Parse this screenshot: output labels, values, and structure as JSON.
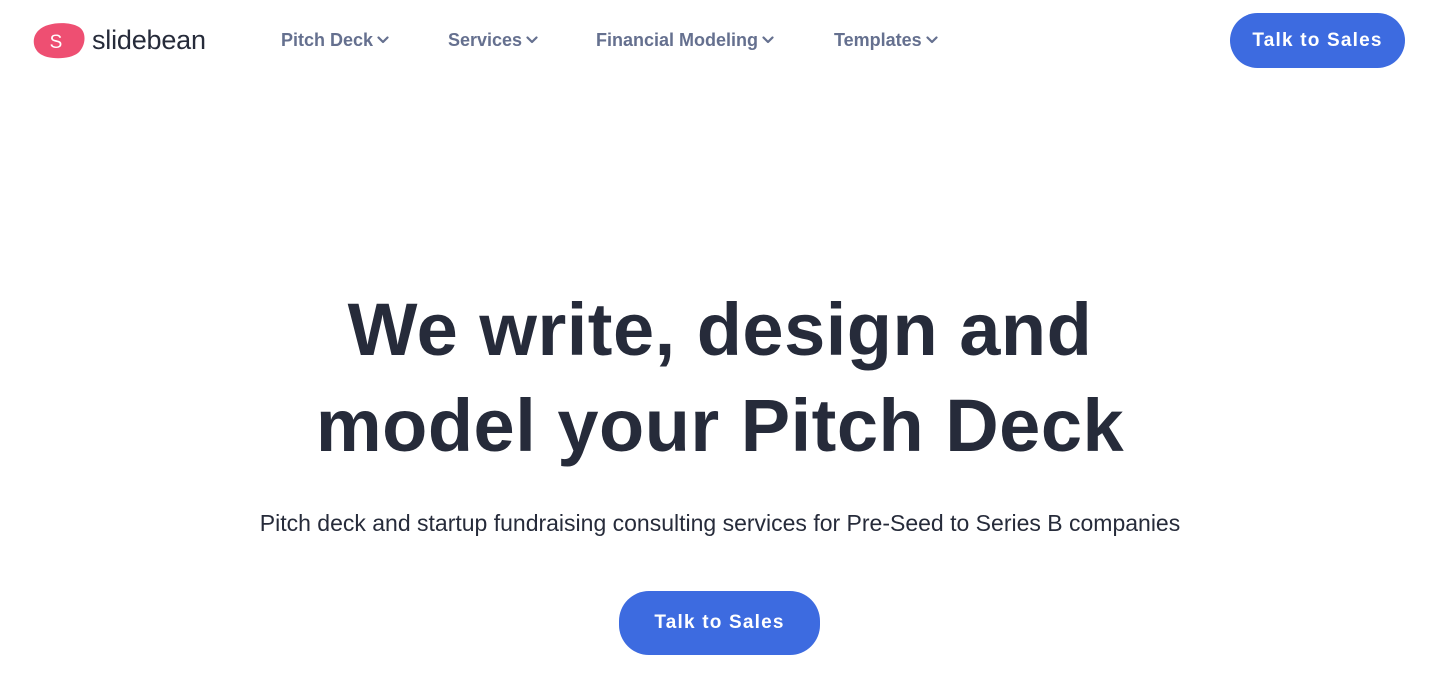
{
  "brand": {
    "logo_letter": "S",
    "name": "slidebean",
    "logo_color": "#ee4f72"
  },
  "nav": {
    "items": [
      {
        "label": "Pitch Deck",
        "icon": "chevron-down-icon"
      },
      {
        "label": "Services",
        "icon": "chevron-down-icon"
      },
      {
        "label": "Financial Modeling",
        "icon": "chevron-down-icon"
      },
      {
        "label": "Templates",
        "icon": "chevron-down-icon"
      }
    ],
    "cta_label": "Talk to Sales"
  },
  "hero": {
    "title_line1": "We write, design and",
    "title_line2": "model your Pitch Deck",
    "subtitle": "Pitch deck and startup fundraising consulting services for Pre-Seed to Series B companies",
    "cta_label": "Talk to Sales"
  },
  "colors": {
    "accent": "#3d6be0",
    "text_dark": "#262b3a",
    "nav_text": "#65708f",
    "brand_pink": "#ee4f72"
  }
}
